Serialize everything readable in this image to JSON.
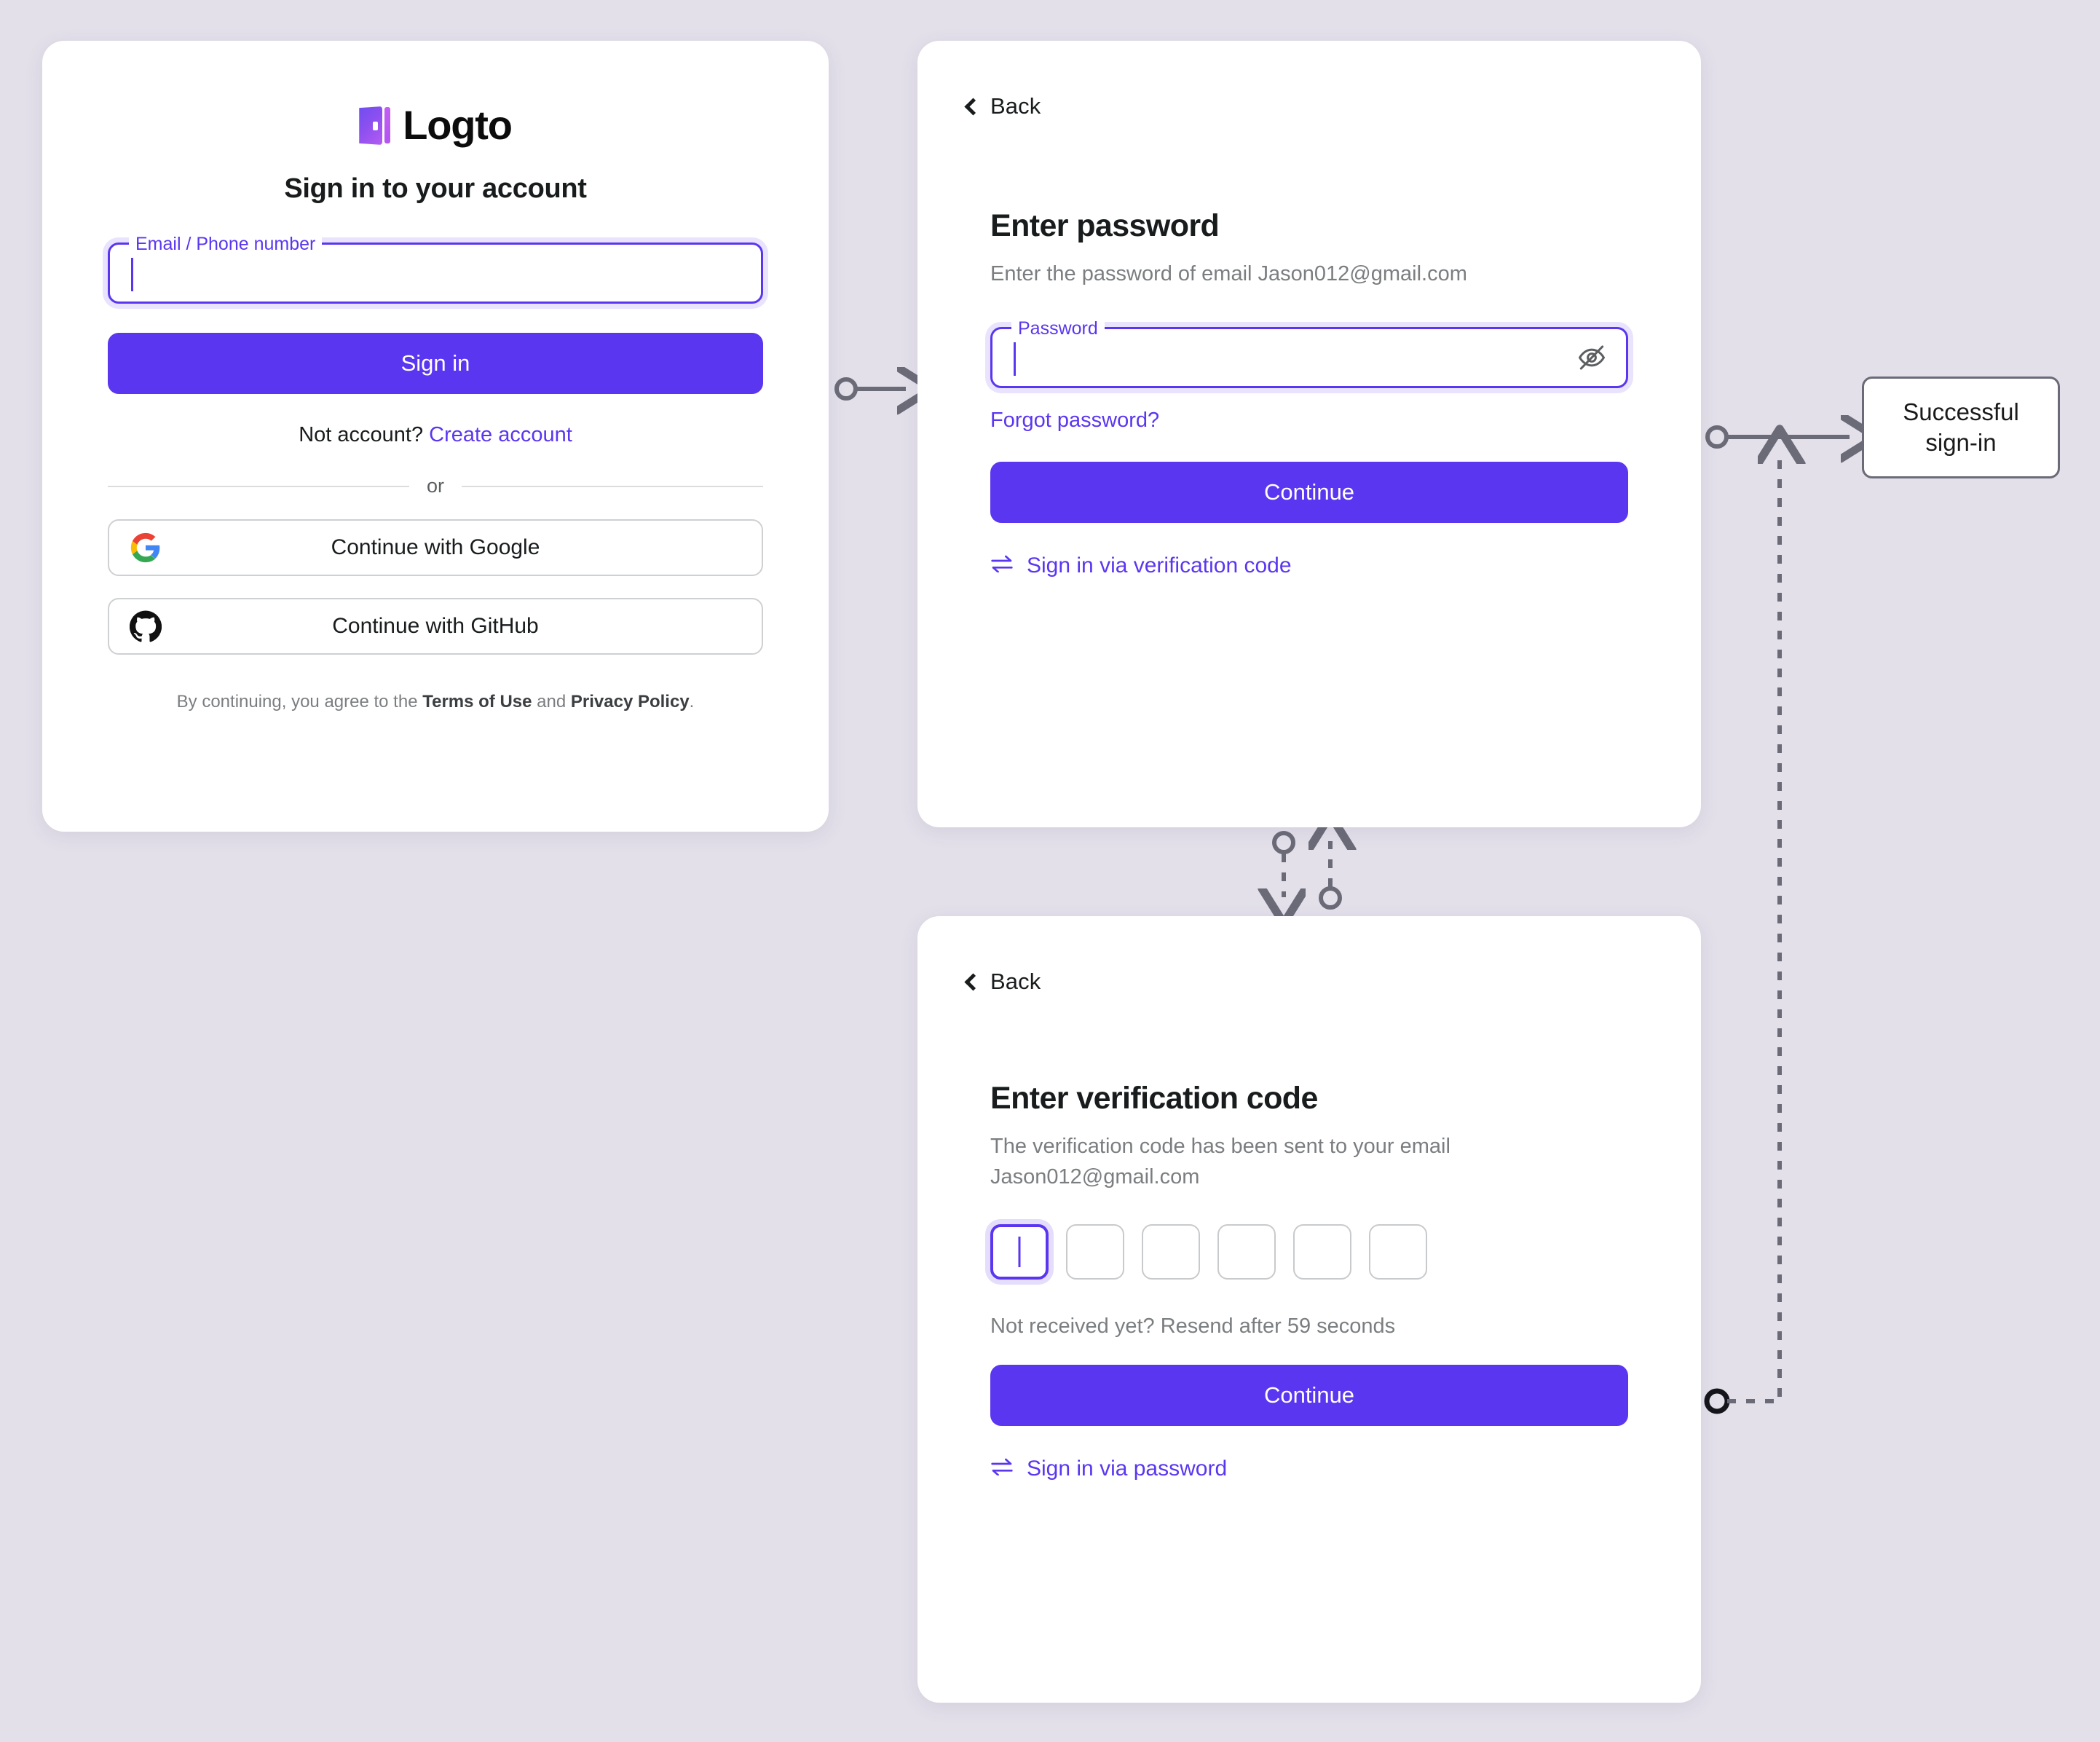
{
  "canvas": {
    "background_color": "#E3E0EA",
    "accent_color": "#5B36F0",
    "card_background": "#FFFFFF"
  },
  "sign_in_card": {
    "logo_text": "Logto",
    "title": "Sign in to your account",
    "email_field": {
      "label": "Email / Phone number",
      "value": ""
    },
    "sign_in_button": "Sign in",
    "signup_prompt": "Not account?",
    "signup_link": "Create account",
    "divider_label": "or",
    "social_buttons": [
      {
        "icon": "google-icon",
        "label": "Continue with Google"
      },
      {
        "icon": "github-icon",
        "label": "Continue with GitHub"
      }
    ],
    "legal": {
      "prefix": "By continuing, you agree to the ",
      "terms": "Terms of Use",
      "middle": " and ",
      "privacy": "Privacy Policy",
      "suffix": "."
    }
  },
  "password_card": {
    "back_label": "Back",
    "title": "Enter password",
    "description": "Enter the password of email Jason012@gmail.com",
    "password_field": {
      "label": "Password",
      "value": "",
      "visibility_icon": "eye-off-icon"
    },
    "forgot_link": "Forgot password?",
    "continue_button": "Continue",
    "switch_link": "Sign in via verification code",
    "switch_icon": "swap-icon"
  },
  "verification_card": {
    "back_label": "Back",
    "title": "Enter verification code",
    "description": "The verification code has been sent to your email Jason012@gmail.com",
    "code_boxes": 6,
    "code_values": [
      "",
      "",
      "",
      "",
      "",
      ""
    ],
    "focused_index": 0,
    "resend_text": "Not received yet? Resend after 59 seconds",
    "continue_button": "Continue",
    "switch_link": "Sign in via password",
    "switch_icon": "swap-icon"
  },
  "success_node": {
    "line1": "Successful",
    "line2": "sign-in"
  }
}
